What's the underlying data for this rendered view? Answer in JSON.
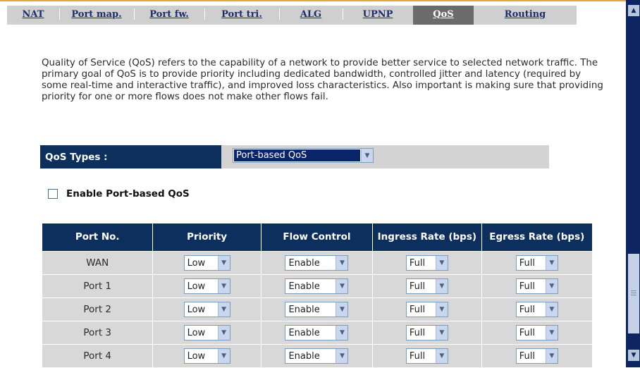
{
  "tabs": [
    {
      "label": "NAT",
      "active": false
    },
    {
      "label": "Port map.",
      "active": false
    },
    {
      "label": "Port fw.",
      "active": false
    },
    {
      "label": "Port tri.",
      "active": false
    },
    {
      "label": "ALG",
      "active": false
    },
    {
      "label": "UPNP",
      "active": false
    },
    {
      "label": "QoS",
      "active": true
    },
    {
      "label": "Routing",
      "active": false
    }
  ],
  "description": "Quality of Service (QoS) refers to the capability of a network to provide better service to selected network traffic. The primary goal of QoS is to provide priority including dedicated bandwidth, controlled jitter and latency (required by some real-time and interactive traffic), and improved loss characteristics. Also important is making sure that providing priority for one or more flows does not make other flows fail.",
  "qos_types": {
    "label": "QoS Types :",
    "selected": "Port-based QoS"
  },
  "enable_port_qos": {
    "label": "Enable Port-based QoS",
    "checked": false
  },
  "table": {
    "headers": [
      "Port No.",
      "Priority",
      "Flow Control",
      "Ingress Rate (bps)",
      "Egress Rate (bps)"
    ],
    "rows": [
      {
        "port": "WAN",
        "priority": "Low",
        "flow": "Enable",
        "ingress": "Full",
        "egress": "Full"
      },
      {
        "port": "Port 1",
        "priority": "Low",
        "flow": "Enable",
        "ingress": "Full",
        "egress": "Full"
      },
      {
        "port": "Port 2",
        "priority": "Low",
        "flow": "Enable",
        "ingress": "Full",
        "egress": "Full"
      },
      {
        "port": "Port 3",
        "priority": "Low",
        "flow": "Enable",
        "ingress": "Full",
        "egress": "Full"
      },
      {
        "port": "Port 4",
        "priority": "Low",
        "flow": "Enable",
        "ingress": "Full",
        "egress": "Full"
      }
    ]
  },
  "colors": {
    "header_bg": "#0c2f5d",
    "tab_active": "#6b6b6b",
    "accent_line": "#e8a33a",
    "scrollbar": "#0c2560"
  }
}
